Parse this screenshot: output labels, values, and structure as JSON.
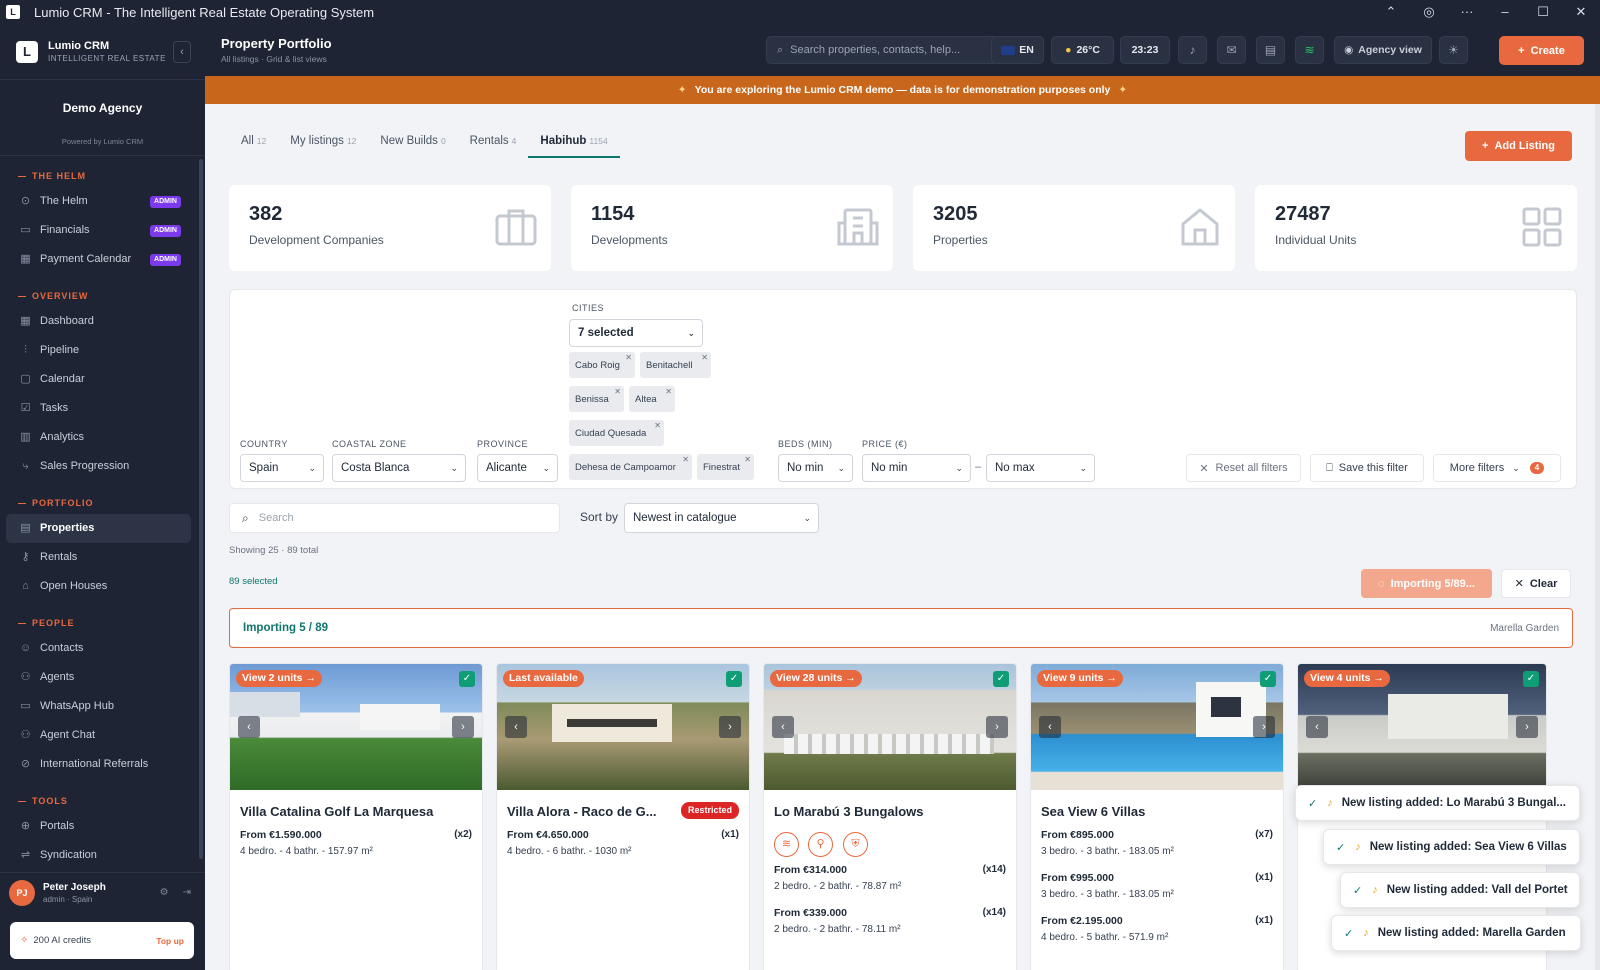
{
  "window": {
    "title": "Lumio CRM - The Intelligent Real Estate Operating System",
    "controls": [
      "⌃",
      "◎",
      "···",
      "–",
      "☐",
      "✕"
    ]
  },
  "brand": {
    "logo_letter": "L",
    "name": "Lumio CRM",
    "subtitle": "INTELLIGENT REAL ESTATE",
    "collapse": "‹"
  },
  "agency": {
    "name": "Demo Agency",
    "powered_by": "Powered by Lumio CRM"
  },
  "sidebar": {
    "sections": [
      {
        "title": "THE HELM",
        "items": [
          {
            "label": "The Helm",
            "icon": "⊙",
            "badge": "ADMIN"
          },
          {
            "label": "Financials",
            "icon": "▭",
            "badge": "ADMIN"
          },
          {
            "label": "Payment Calendar",
            "icon": "▦",
            "badge": "ADMIN"
          }
        ]
      },
      {
        "title": "OVERVIEW",
        "items": [
          {
            "label": "Dashboard",
            "icon": "▦"
          },
          {
            "label": "Pipeline",
            "icon": "⫶"
          },
          {
            "label": "Calendar",
            "icon": "▢"
          },
          {
            "label": "Tasks",
            "icon": "☑"
          },
          {
            "label": "Analytics",
            "icon": "▥"
          },
          {
            "label": "Sales Progression",
            "icon": "⤷"
          }
        ]
      },
      {
        "title": "PORTFOLIO",
        "items": [
          {
            "label": "Properties",
            "icon": "▤",
            "active": true
          },
          {
            "label": "Rentals",
            "icon": "⚷"
          },
          {
            "label": "Open Houses",
            "icon": "⌂"
          }
        ]
      },
      {
        "title": "PEOPLE",
        "items": [
          {
            "label": "Contacts",
            "icon": "☺"
          },
          {
            "label": "Agents",
            "icon": "⚇"
          },
          {
            "label": "WhatsApp Hub",
            "icon": "▭"
          },
          {
            "label": "Agent Chat",
            "icon": "⚇"
          },
          {
            "label": "International Referrals",
            "icon": "⊘"
          }
        ]
      },
      {
        "title": "TOOLS",
        "items": [
          {
            "label": "Portals",
            "icon": "⊕"
          },
          {
            "label": "Syndication",
            "icon": "⇌"
          }
        ]
      }
    ],
    "user": {
      "initials": "PJ",
      "name": "Peter Joseph",
      "role": "admin · Spain"
    },
    "credits": {
      "label": "200 AI credits",
      "action": "Top up"
    }
  },
  "header": {
    "title": "Property Portfolio",
    "subtitle": "All listings · Grid & list views",
    "search_placeholder": "Search properties, contacts, help...",
    "language": "EN",
    "weather": "26°C",
    "time": "23:23",
    "agency_view": "Agency view",
    "create": "Create"
  },
  "banner": {
    "text": "You are exploring the Lumio CRM demo — data is for demonstration purposes only"
  },
  "tabs": [
    {
      "label": "All",
      "count": "12"
    },
    {
      "label": "My listings",
      "count": "12"
    },
    {
      "label": "New Builds",
      "count": "0"
    },
    {
      "label": "Rentals",
      "count": "4"
    },
    {
      "label": "Habihub",
      "count": "1154",
      "active": true
    }
  ],
  "add_listing": "Add Listing",
  "stats": [
    {
      "value": "382",
      "label": "Development Companies",
      "icon": "briefcase-icon"
    },
    {
      "value": "1154",
      "label": "Developments",
      "icon": "building-icon"
    },
    {
      "value": "3205",
      "label": "Properties",
      "icon": "house-icon"
    },
    {
      "value": "27487",
      "label": "Individual Units",
      "icon": "grid-icon"
    }
  ],
  "filters": {
    "country": {
      "label": "COUNTRY",
      "value": "Spain"
    },
    "coastal_zone": {
      "label": "COASTAL ZONE",
      "value": "Costa Blanca"
    },
    "province": {
      "label": "PROVINCE",
      "value": "Alicante"
    },
    "cities": {
      "label": "CITIES",
      "value": "7 selected",
      "tags": [
        "Cabo Roig",
        "Benitachell",
        "Benissa",
        "Altea",
        "Ciudad Quesada",
        "Dehesa de Campoamor",
        "Finestrat"
      ]
    },
    "beds": {
      "label": "BEDS (MIN)",
      "value": "No min"
    },
    "price": {
      "label": "PRICE (€)",
      "min": "No min",
      "sep": "–",
      "max": "No max"
    },
    "reset": "Reset all filters",
    "save": "Save this filter",
    "more": "More filters",
    "more_count": "4"
  },
  "list": {
    "search_placeholder": "Search",
    "sort_label": "Sort by",
    "sort_value": "Newest in catalogue",
    "showing": "Showing 25 · 89 total",
    "selected": "89 selected",
    "importing_button": "Importing 5/89...",
    "clear": "Clear",
    "progress_label": "Importing 5 / 89",
    "progress_current": "Marella Garden"
  },
  "cards": [
    {
      "pill": "View 2 units →",
      "name": "Villa Catalina Golf La Marquesa",
      "units": [
        {
          "price": "From €1.590.000",
          "mult": "(x2)",
          "spec": "4 bedro. - 4 bathr. - 157.97 m²"
        }
      ]
    },
    {
      "pill": "Last available",
      "name": "Villa Alora - Raco de G...",
      "badge": "Restricted",
      "units": [
        {
          "price": "From €4.650.000",
          "mult": "(x1)",
          "spec": "4 bedro. - 6 bathr. - 1030 m²"
        }
      ]
    },
    {
      "pill": "View 28 units →",
      "name": "Lo Marabú 3 Bungalows",
      "amenities": [
        "≋",
        "⚲",
        "⛨"
      ],
      "units": [
        {
          "price": "From €314.000",
          "mult": "(x14)",
          "spec": "2 bedro. - 2 bathr. - 78.87 m²"
        },
        {
          "price": "From €339.000",
          "mult": "(x14)",
          "spec": "2 bedro. - 2 bathr. - 78.11 m²"
        }
      ]
    },
    {
      "pill": "View 9 units →",
      "name": "Sea View 6 Villas",
      "units": [
        {
          "price": "From €895.000",
          "mult": "(x7)",
          "spec": "3 bedro. - 3 bathr. - 183.05 m²"
        },
        {
          "price": "From €995.000",
          "mult": "(x1)",
          "spec": "3 bedro. - 3 bathr. - 183.05 m²"
        },
        {
          "price": "From €2.195.000",
          "mult": "(x1)",
          "spec": "4 bedro. - 5 bathr. - 571.9 m²"
        }
      ]
    },
    {
      "pill": "View 4 units →",
      "name": "",
      "units": []
    }
  ],
  "toasts": [
    "New listing added: Lo Marabú 3 Bungal...",
    "New listing added: Sea View 6 Villas",
    "New listing added: Vall del Portet",
    "New listing added: Marella Garden"
  ],
  "colors": {
    "accent": "#e8693f",
    "sidebar": "#1e2433",
    "teal": "#0f766e",
    "admin_badge": "#7c3aed",
    "restricted": "#dc2626",
    "banner": "#c8661b"
  }
}
